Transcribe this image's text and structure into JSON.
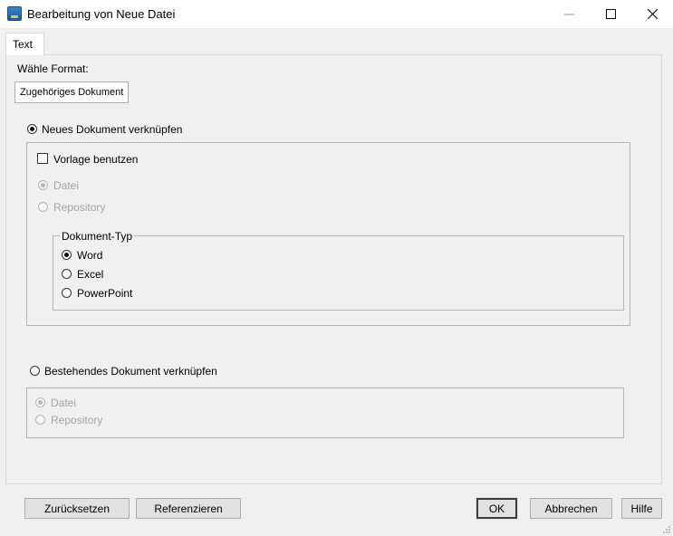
{
  "window": {
    "title": "Bearbeitung von Neue Datei",
    "controls": {
      "minimize": "minimize",
      "maximize": "maximize",
      "close": "close"
    }
  },
  "tabs": [
    {
      "label": "Text",
      "active": true
    }
  ],
  "format": {
    "label": "Wähle Format:",
    "inner_tab": "Zugehöriges Dokument"
  },
  "new_document": {
    "radio_label": "Neues Dokument verknüpfen",
    "selected": true,
    "use_template_label": "Vorlage benutzen",
    "use_template_checked": false,
    "source_options": [
      {
        "label": "Datei",
        "checked": true,
        "enabled": false
      },
      {
        "label": "Repository",
        "checked": false,
        "enabled": false
      }
    ],
    "doc_type": {
      "legend": "Dokument-Typ",
      "options": [
        {
          "label": "Word",
          "checked": true
        },
        {
          "label": "Excel",
          "checked": false
        },
        {
          "label": "PowerPoint",
          "checked": false
        }
      ]
    }
  },
  "existing_document": {
    "radio_label": "Bestehendes Dokument verknüpfen",
    "selected": false,
    "source_options": [
      {
        "label": "Datei",
        "checked": true,
        "enabled": false
      },
      {
        "label": "Repository",
        "checked": false,
        "enabled": false
      }
    ]
  },
  "buttons": {
    "reset": "Zurücksetzen",
    "references": "Referenzieren",
    "ok": "OK",
    "cancel": "Abbrechen",
    "help": "Hilfe"
  },
  "colors": {
    "window_bg": "#f0f0f0",
    "titlebar_bg": "#ffffff",
    "disabled_text": "#a3a3a3"
  }
}
